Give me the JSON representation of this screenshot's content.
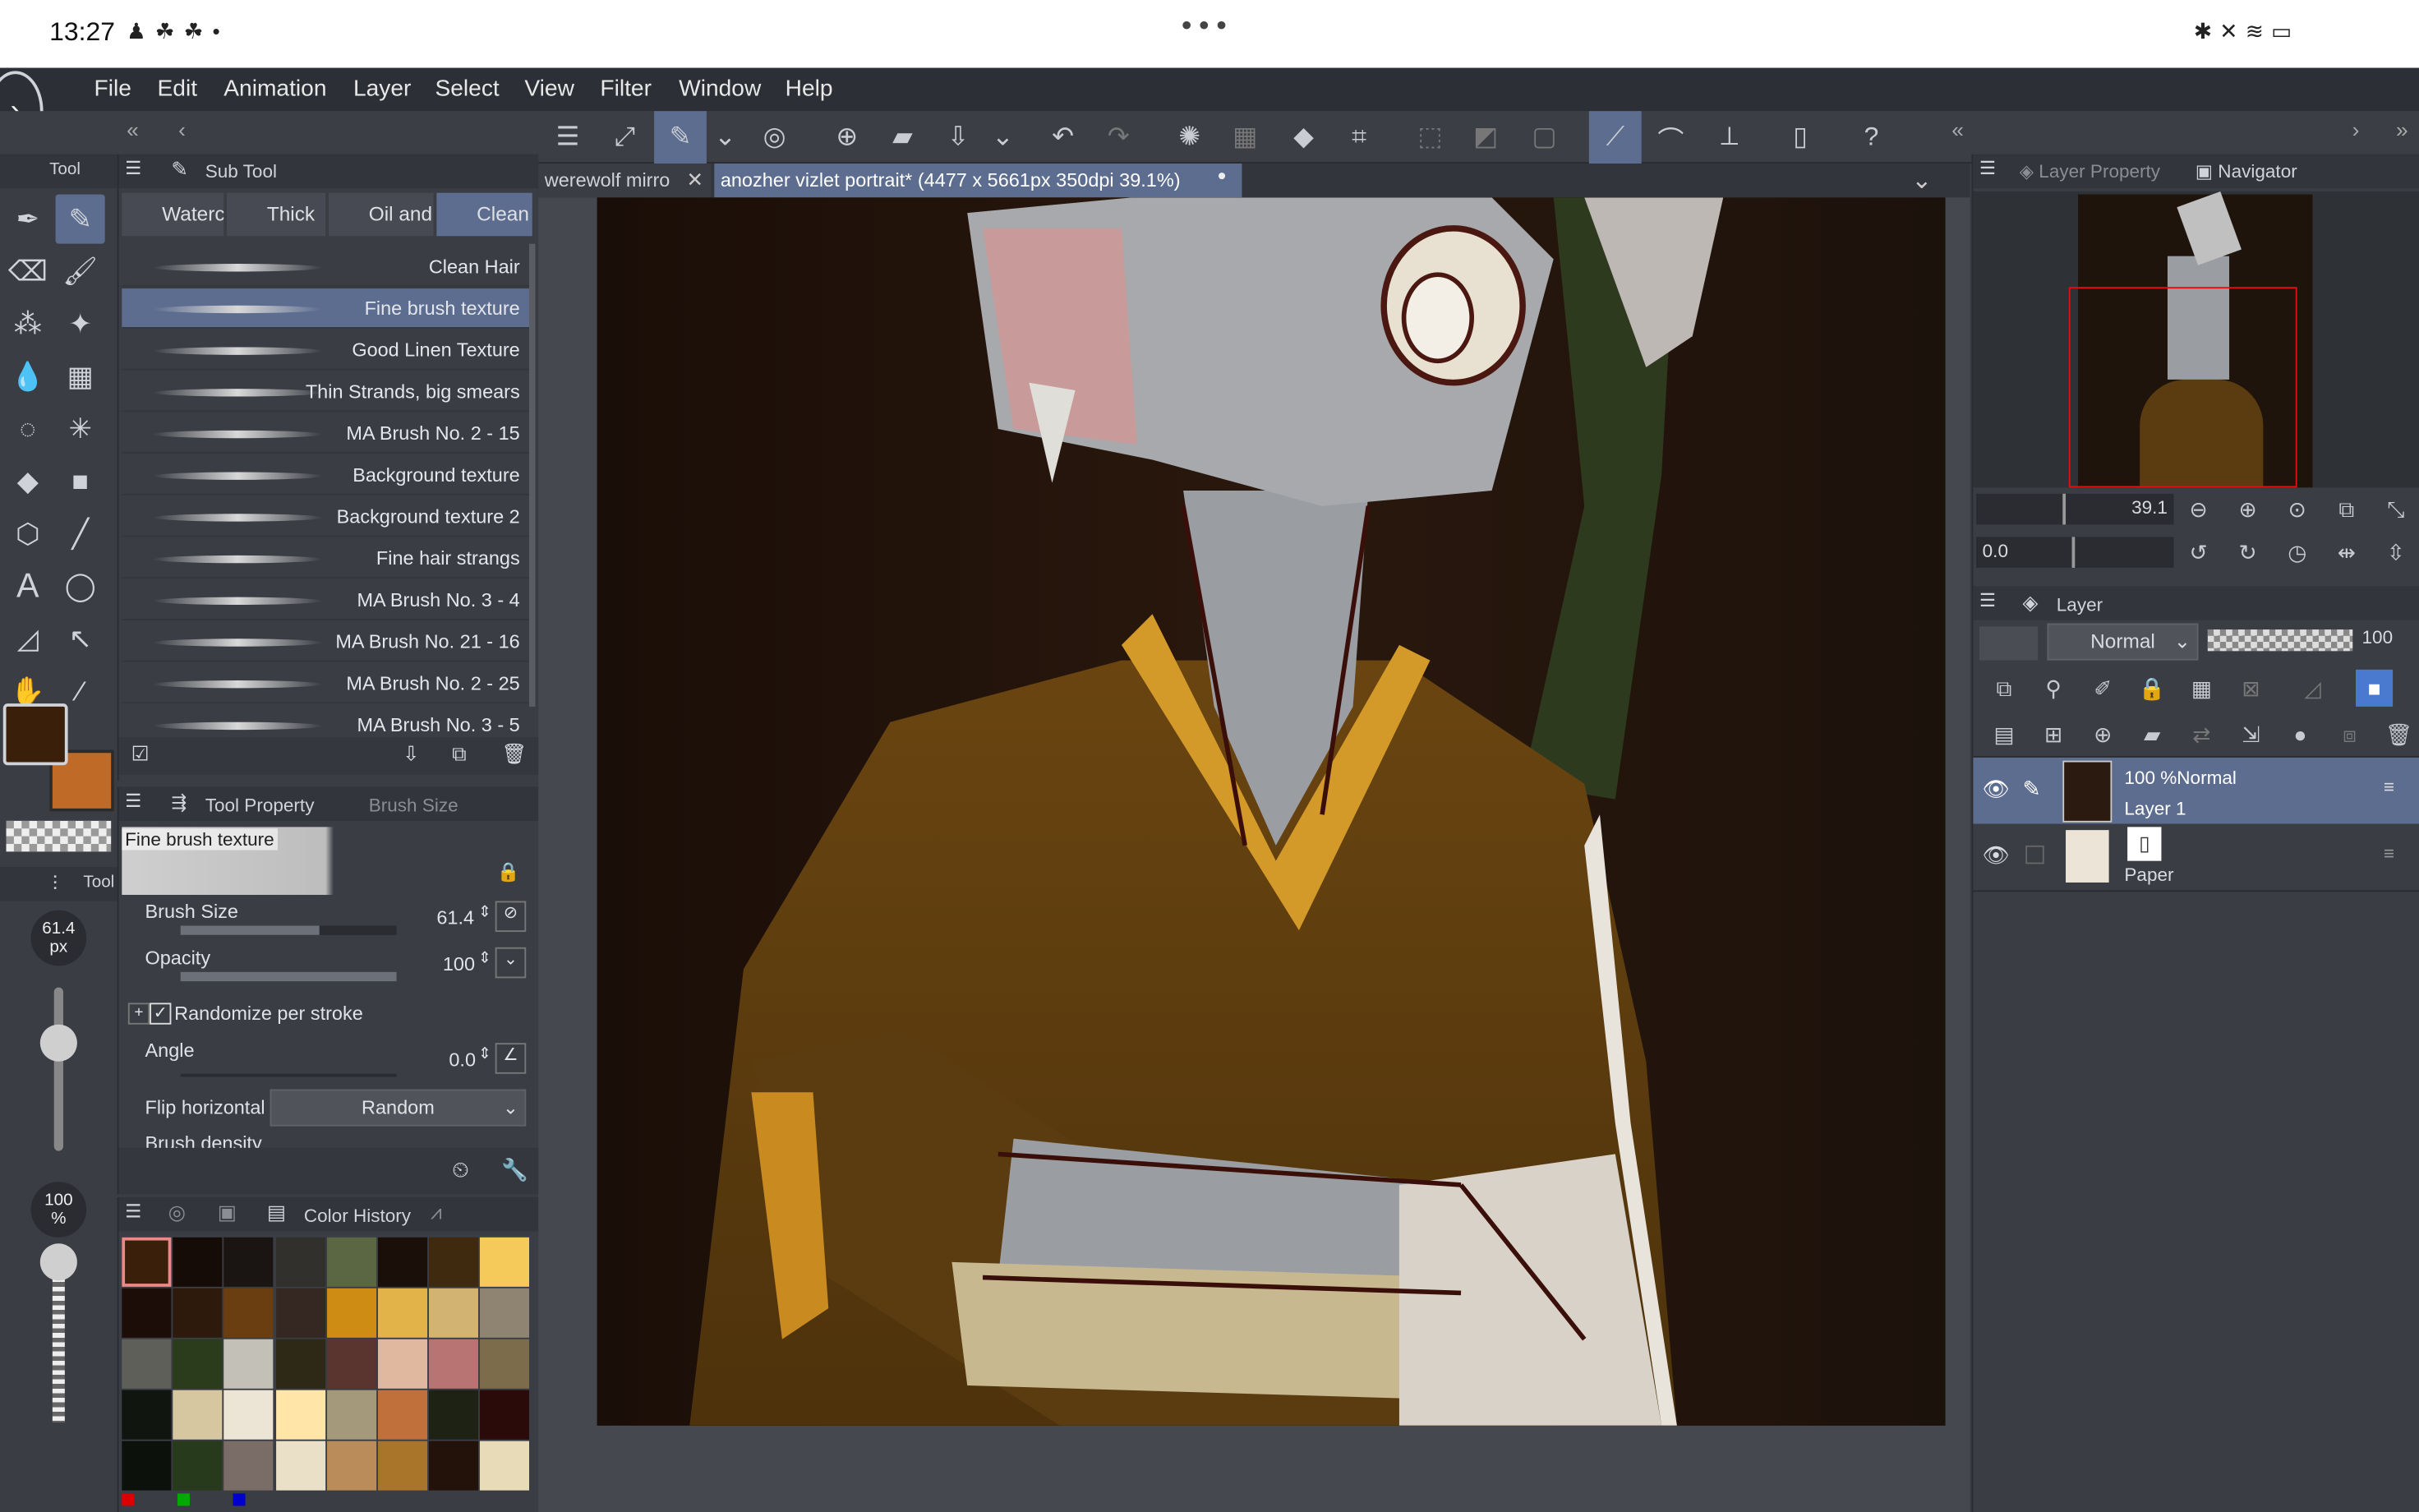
{
  "status_bar": {
    "time": "13:27",
    "dots": "• • •"
  },
  "menu": {
    "items": [
      "File",
      "Edit",
      "Animation",
      "Layer",
      "Select",
      "View",
      "Filter",
      "Window",
      "Help"
    ]
  },
  "panels": {
    "tool_title": "Tool",
    "subtool_title": "Sub Tool",
    "subtool_tabs": [
      "Watercolor",
      "Thick",
      "Oil and",
      "Clean"
    ],
    "tool_property_title": "Tool Property",
    "brush_size_tab": "Brush Size",
    "color_history_title": "Color History",
    "tool2_title": "Tool"
  },
  "brushes": [
    {
      "name": "Clean Hair",
      "selected": false
    },
    {
      "name": "Fine brush texture",
      "selected": true
    },
    {
      "name": "Good Linen Texture",
      "selected": false
    },
    {
      "name": "Thin Strands, big smears",
      "selected": false
    },
    {
      "name": "MA Brush No.   2 - 15",
      "selected": false
    },
    {
      "name": "Background texture",
      "selected": false
    },
    {
      "name": "Background texture 2",
      "selected": false
    },
    {
      "name": "Fine hair strangs",
      "selected": false
    },
    {
      "name": "MA Brush No.   3 - 4",
      "selected": false
    },
    {
      "name": "MA Brush No.   21 - 16",
      "selected": false
    },
    {
      "name": "MA Brush No.   2 - 25",
      "selected": false
    },
    {
      "name": "MA Brush No.   3 - 5",
      "selected": false
    }
  ],
  "tool_property": {
    "preview_label": "Fine brush texture",
    "brush_size_label": "Brush Size",
    "brush_size_value": "61.4",
    "opacity_label": "Opacity",
    "opacity_value": "100",
    "randomize_label": "Randomize per stroke",
    "angle_label": "Angle",
    "angle_value": "0.0",
    "flip_label": "Flip horizontal",
    "flip_value": "Random",
    "brush_density_label": "Brush density"
  },
  "left_indicators": {
    "size": "61.4",
    "size_unit": "px",
    "opacity": "100",
    "opacity_unit": "%"
  },
  "colors": {
    "main": "#3a1f0a",
    "sub": "#c06a28",
    "accent": "#5d6d8f",
    "history": [
      [
        "#3a1f0a",
        "#150c08",
        "#1a1512",
        "#31302c",
        "#5b6642",
        "#1b0f0a",
        "#3f2a10",
        "#f5c95a"
      ],
      [
        "#1d0d08",
        "#2d1a0d",
        "#6a3e10",
        "#352822",
        "#cf8c15",
        "#e2b349",
        "#d2b371",
        "#8f8472"
      ],
      [
        "#5f5f5a",
        "#2b3c1c",
        "#c3c0b7",
        "#2d2916",
        "#5a3530",
        "#e0b8a0",
        "#b87472",
        "#7d6c4c"
      ],
      [
        "#101510",
        "#d7c7a0",
        "#ece5d6",
        "#ffe5a8",
        "#a49a7b",
        "#c0703a",
        "#1d2214",
        "#2a0b0a"
      ],
      [
        "#0c110c",
        "#283a1c",
        "#7a6d68",
        "#eae0c8",
        "#b98c5a",
        "#a8752b",
        "#22120a",
        "#e8dcb8"
      ]
    ]
  },
  "doc_tabs": [
    {
      "label": "werewolf mirro",
      "active": false
    },
    {
      "label": "anozher vizlet portrait* (4477 x 5661px 350dpi 39.1%)",
      "active": true
    }
  ],
  "right_panel": {
    "layer_property_tab": "Layer Property",
    "navigator_tab": "Navigator",
    "zoom_value": "39.1",
    "rotate_value": "0.0",
    "layer_title": "Layer",
    "blend_mode": "Normal",
    "layer_opacity": "100",
    "layers": [
      {
        "mode": "100 %Normal",
        "name": "Layer 1",
        "selected": true
      },
      {
        "mode": "",
        "name": "Paper",
        "selected": false
      }
    ]
  }
}
